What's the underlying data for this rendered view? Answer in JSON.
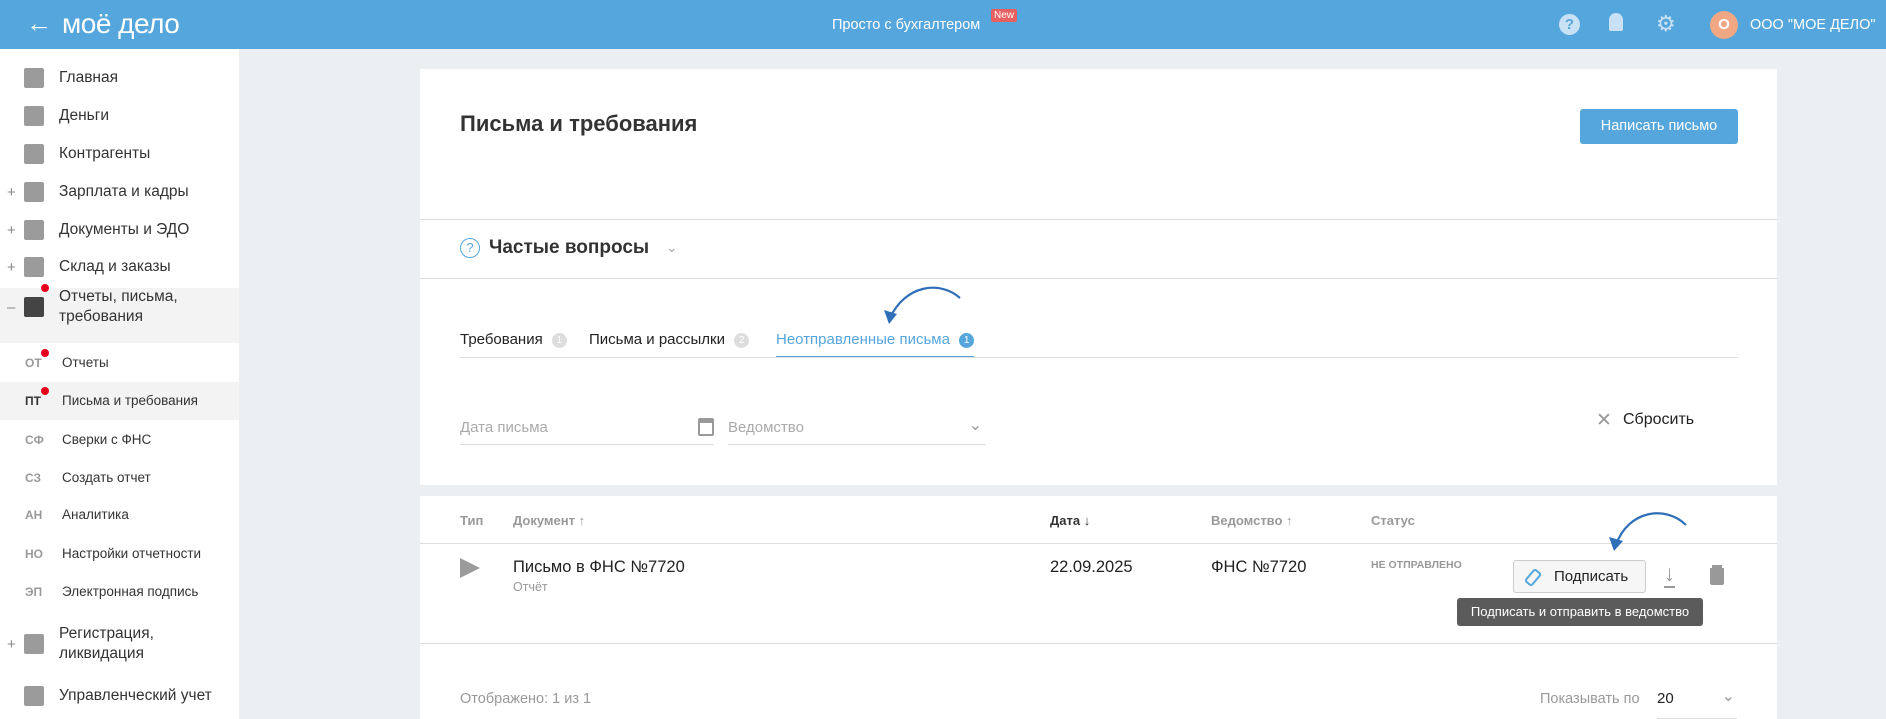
{
  "header": {
    "logo": "моё дело",
    "promo": "Просто с бухгалтером",
    "promo_badge": "New",
    "avatar_letter": "О",
    "company": "ООО \"МОЕ ДЕЛО\""
  },
  "sidebar": {
    "items": [
      {
        "label": "Главная",
        "icon": "home-icon"
      },
      {
        "label": "Деньги",
        "icon": "money-icon"
      },
      {
        "label": "Контрагенты",
        "icon": "contractor-icon"
      },
      {
        "label": "Зарплата и кадры",
        "icon": "salary-icon",
        "expand": "+"
      },
      {
        "label": "Документы и ЭДО",
        "icon": "documents-icon",
        "expand": "+"
      },
      {
        "label": "Склад и заказы",
        "icon": "warehouse-icon",
        "expand": "+"
      },
      {
        "label": "Отчеты, письма, требования",
        "icon": "reports-icon",
        "expand": "–"
      },
      {
        "label": "Регистрация, ликвидация",
        "icon": "registration-icon",
        "expand": "+"
      },
      {
        "label": "Управленческий учет",
        "icon": "management-icon"
      }
    ],
    "subitems": [
      {
        "abbr": "ОТ",
        "label": "Отчеты"
      },
      {
        "abbr": "ПТ",
        "label": "Письма и требования"
      },
      {
        "abbr": "СФ",
        "label": "Сверки с ФНС"
      },
      {
        "abbr": "СЗ",
        "label": "Создать отчет"
      },
      {
        "abbr": "АН",
        "label": "Аналитика"
      },
      {
        "abbr": "НО",
        "label": "Настройки отчетности"
      },
      {
        "abbr": "ЭП",
        "label": "Электронная подпись"
      }
    ]
  },
  "page": {
    "title": "Письма и требования",
    "write_button": "Написать письмо",
    "faq": "Частые вопросы"
  },
  "tabs": [
    {
      "label": "Требования",
      "count": "1"
    },
    {
      "label": "Письма и рассылки",
      "count": "2"
    },
    {
      "label": "Неотправленные письма",
      "count": "1"
    }
  ],
  "filters": {
    "date_placeholder": "Дата письма",
    "agency_placeholder": "Ведомство",
    "reset": "Сбросить"
  },
  "table": {
    "headers": [
      "Тип",
      "Документ ↑",
      "Дата ↓",
      "Ведомство ↑",
      "Статус"
    ],
    "rows": [
      {
        "document": "Письмо в ФНС №7720",
        "subtitle": "Отчёт",
        "date": "22.09.2025",
        "agency": "ФНС №7720",
        "status": "НЕ ОТПРАВЛЕНО",
        "sign": "Подписать"
      }
    ],
    "tooltip": "Подписать и отправить в ведомство"
  },
  "footer": {
    "shown": "Отображено: 1 из 1",
    "per_page_label": "Показывать по",
    "per_page": "20"
  },
  "colors": {
    "accent": "#55a6dc",
    "badge_red": "#e8001c"
  }
}
